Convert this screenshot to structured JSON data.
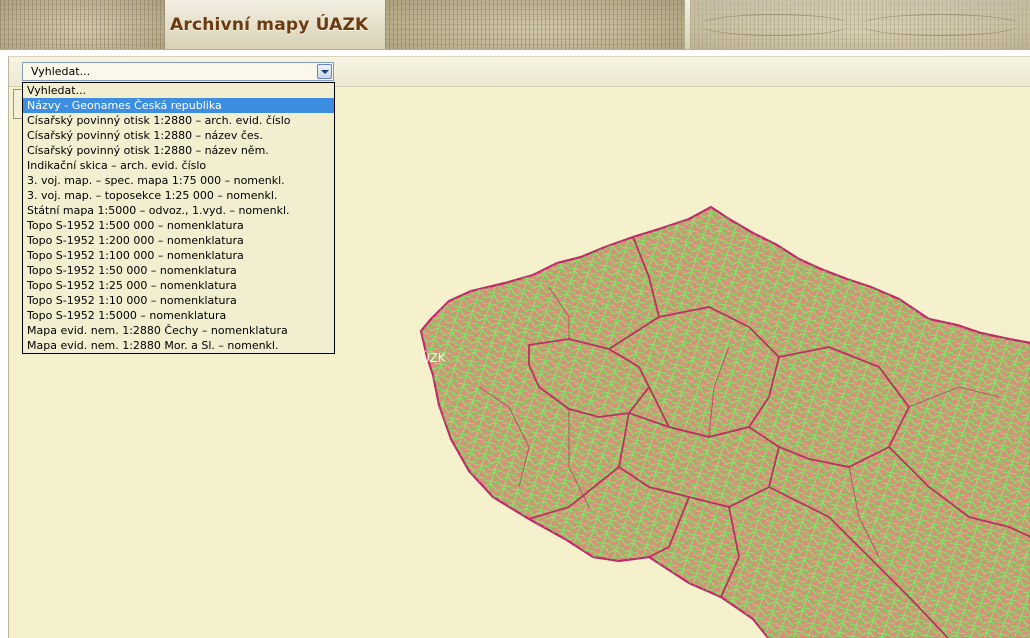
{
  "header": {
    "title": "Archivní mapy ÚAZK"
  },
  "search": {
    "value": "Vyhledat...",
    "dropdown_icon": "chevron-down-icon",
    "selected_index": 1,
    "options": [
      "Vyhledat...",
      "Názvy - Geonames Česká republika",
      "Císařský povinný otisk 1:2880 – arch. evid. číslo",
      "Císařský povinný otisk 1:2880 – název čes.",
      "Císařský povinný otisk 1:2880 – název něm.",
      "Indikační skica – arch. evid. číslo",
      "3. voj. map. – spec. mapa 1:75 000 – nomenkl.",
      "3. voj. map. – toposekce 1:25 000 – nomenkl.",
      "Státní mapa 1:5000 – odvoz., 1.vyd. – nomenkl.",
      "Topo S-1952 1:500 000 – nomenklatura",
      "Topo S-1952 1:200 000 – nomenklatura",
      "Topo S-1952 1:100 000 – nomenklatura",
      "Topo S-1952 1:50 000 – nomenklatura",
      "Topo S-1952 1:25 000 – nomenklatura",
      "Topo S-1952 1:10 000 – nomenklatura",
      "Topo S-1952 1:5000 – nomenklatura",
      "Mapa evid. nem. 1:2880 Čechy – nomenklatura",
      "Mapa evid. nem. 1:2880 Mor. a Sl. – nomenkl."
    ]
  },
  "map": {
    "watermark": "ÚZK",
    "colors": {
      "background": "#f5f1cc",
      "fill": "#d98f7a",
      "cadastral_lines": "#7ef06a",
      "region_border": "#c0286a",
      "district_border": "#b8335e"
    }
  }
}
